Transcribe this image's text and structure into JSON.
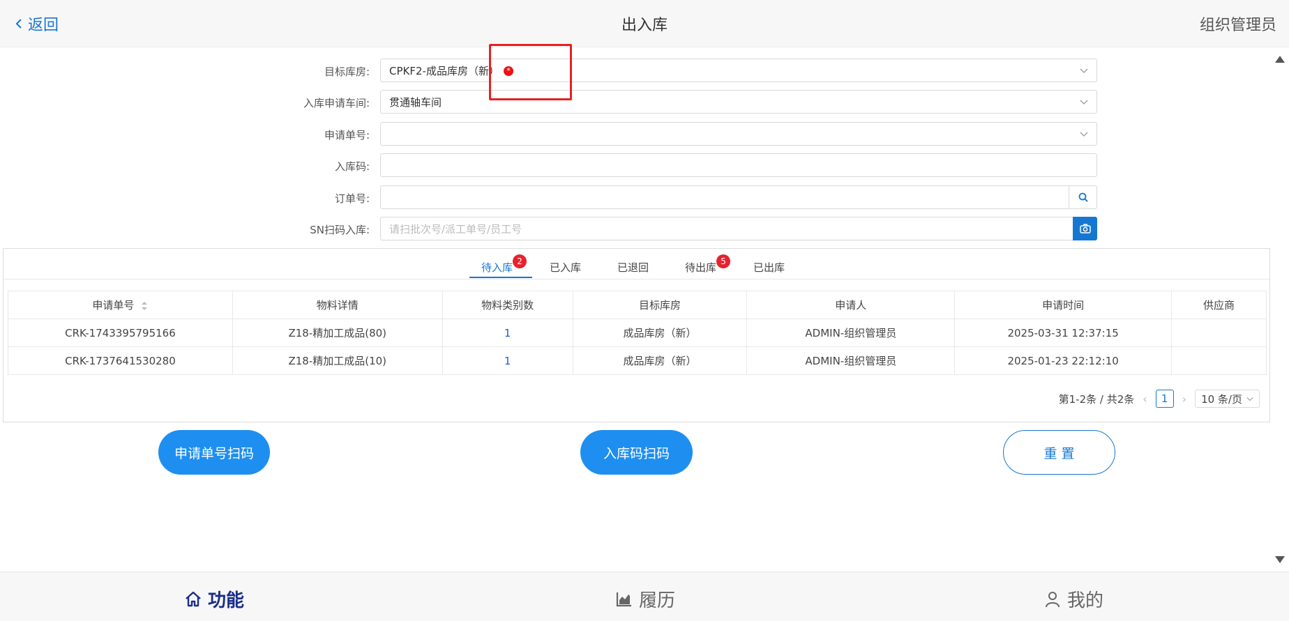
{
  "header": {
    "back_label": "返回",
    "title": "出入库",
    "role": "组织管理员"
  },
  "form": {
    "target_warehouse": {
      "label": "目标库房:",
      "value": "CPKF2-成品库房（新）",
      "required_mark": "*"
    },
    "workshop": {
      "label": "入库申请车间:",
      "value": "贯通轴车间"
    },
    "apply_no": {
      "label": "申请单号:",
      "value": ""
    },
    "inbound_code": {
      "label": "入库码:",
      "value": ""
    },
    "order_no": {
      "label": "订单号:",
      "value": ""
    },
    "sn_scan": {
      "label": "SN扫码入库:",
      "placeholder": "请扫批次号/派工单号/员工号"
    }
  },
  "tabs": [
    {
      "label": "待入库",
      "badge": "2"
    },
    {
      "label": "已入库"
    },
    {
      "label": "已退回"
    },
    {
      "label": "待出库",
      "badge": "5"
    },
    {
      "label": "已出库"
    }
  ],
  "table": {
    "columns": [
      "申请单号",
      "物料详情",
      "物料类别数",
      "目标库房",
      "申请人",
      "申请时间",
      "供应商"
    ],
    "rows": [
      [
        "CRK-1743395795166",
        "Z18-精加工成品(80)",
        "1",
        "成品库房（新）",
        "ADMIN-组织管理员",
        "2025-03-31 12:37:15",
        ""
      ],
      [
        "CRK-1737641530280",
        "Z18-精加工成品(10)",
        "1",
        "成品库房（新）",
        "ADMIN-组织管理员",
        "2025-01-23 22:12:10",
        ""
      ]
    ]
  },
  "pager": {
    "summary": "第1-2条 / 共2条",
    "current": "1",
    "page_size": "10 条/页"
  },
  "buttons": {
    "apply_scan": "申请单号扫码",
    "inbound_scan": "入库码扫码",
    "reset": "重 置"
  },
  "bottom_nav": [
    {
      "label": "功能",
      "icon": "home-icon",
      "active": true
    },
    {
      "label": "履历",
      "icon": "chart-icon",
      "active": false
    },
    {
      "label": "我的",
      "icon": "user-icon",
      "active": false
    }
  ],
  "colors": {
    "primary": "#1677d2",
    "button_blue": "#1e8ff0",
    "badge_red": "#e8212e",
    "annotation_red": "#e52222",
    "nav_active": "#1a2e8a"
  }
}
